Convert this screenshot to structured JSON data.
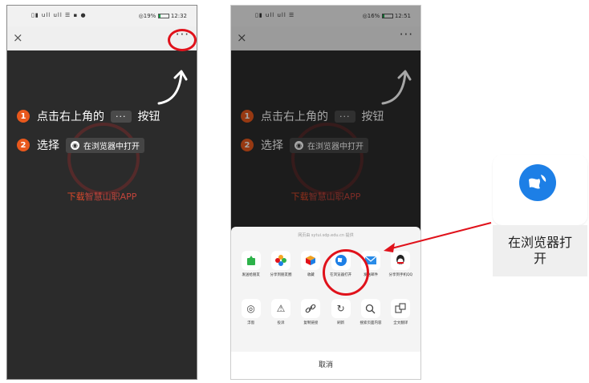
{
  "phone1": {
    "status_left": "▯▮ ull ull ☰ ▪ ●",
    "status_right": "◎19%",
    "status_time": "12:32",
    "close_label": "×",
    "more_label": "···",
    "step1_num": "1",
    "step1_text": "点击右上角的",
    "step1_chip": "···",
    "step1_suffix": "按钮",
    "step2_num": "2",
    "step2_text": "选择",
    "step2_chip": "在浏览器中打开",
    "download_prefix": "下载",
    "download_app": "智慧山职APP"
  },
  "phone2": {
    "status_left": "▯▮ ull ull ☰",
    "status_right": "◎16%",
    "status_time": "12:51",
    "close_label": "×",
    "more_label": "···",
    "step1_num": "1",
    "step1_text": "点击右上角的",
    "step1_chip": "···",
    "step1_suffix": "按钮",
    "step2_num": "2",
    "step2_text": "选择",
    "step2_chip": "在浏览器中打开",
    "download_prefix": "下载",
    "download_app": "智慧山职APP",
    "sheet_source": "网页由 sytui.sdp.edu.cn 提供",
    "share_items": [
      {
        "label": "发送给朋友",
        "icon": "send-to-friend-icon",
        "color": "#2db24a"
      },
      {
        "label": "分享到朋友圈",
        "icon": "moments-icon",
        "color": "#f5a623"
      },
      {
        "label": "收藏",
        "icon": "favorite-icon",
        "color": "#f0a020"
      },
      {
        "label": "在浏览器打开",
        "icon": "browser-icon",
        "color": "#1d7fe6"
      },
      {
        "label": "发送邮件",
        "icon": "mail-icon",
        "color": "#2a8ce8"
      },
      {
        "label": "分享到手机QQ",
        "icon": "qq-icon",
        "color": "#222222"
      }
    ],
    "tool_items": [
      {
        "label": "浮窗",
        "icon": "float-window-icon"
      },
      {
        "label": "投诉",
        "icon": "complaint-icon"
      },
      {
        "label": "复制链接",
        "icon": "copy-link-icon"
      },
      {
        "label": "刷新",
        "icon": "refresh-icon"
      },
      {
        "label": "搜索页面内容",
        "icon": "search-page-icon"
      },
      {
        "label": "全文翻译",
        "icon": "translate-icon"
      }
    ],
    "cancel_label": "取消"
  },
  "zoom_card": {
    "label_line1": "在浏览器打",
    "label_line2": "开",
    "icon": "browser-icon",
    "color": "#1d7fe6"
  },
  "colors": {
    "highlight_red": "#e0121b",
    "step_orange": "#e8581c",
    "dark_bg": "#2b2b2b"
  }
}
